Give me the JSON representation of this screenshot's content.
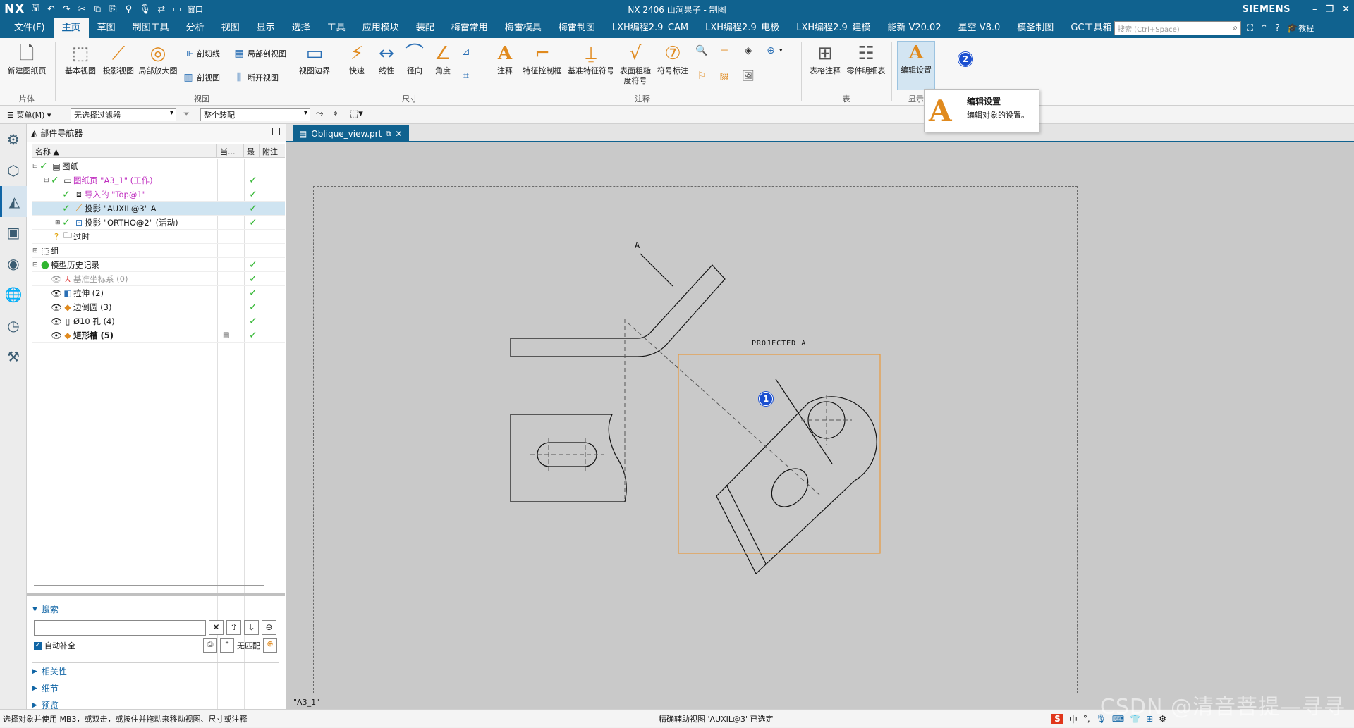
{
  "titlebar": {
    "logo": "NX",
    "window_menu": "窗口",
    "title": "NX 2406 山涧果子 - 制图",
    "brand": "SIEMENS"
  },
  "menu": {
    "items": [
      "文件(F)",
      "主页",
      "草图",
      "制图工具",
      "分析",
      "视图",
      "显示",
      "选择",
      "工具",
      "应用模块",
      "装配",
      "梅雷常用",
      "梅雷模具",
      "梅雷制图",
      "LXH编程2.9_CAM",
      "LXH编程2.9_电极",
      "LXH编程2.9_建模",
      "能新 V20.02",
      "星空 V8.0",
      "模圣制图",
      "GC工具箱"
    ],
    "search_placeholder": "搜索 (Ctrl+Space)",
    "help": "教程"
  },
  "ribbon": {
    "new_sheet": "新建图纸页",
    "base_view": "基本视图",
    "proj_view": "投影视图",
    "detail_view": "局部放大图",
    "section_line": "剖切线",
    "sect_view": "剖视图",
    "break_sect": "局部剖视图",
    "broken_view": "断开视图",
    "view_border": "视图边界",
    "rapid": "快速",
    "linear": "线性",
    "radial": "径向",
    "angular": "角度",
    "note": "注释",
    "fcf": "特征控制框",
    "datum": "基准特征符号",
    "surface1": "表面粗糙",
    "surface2": "度符号",
    "symbol": "符号标注",
    "table_note": "表格注释",
    "parts_list": "零件明细表",
    "edit_settings": "编辑设置",
    "groups": {
      "sheet": "片体",
      "view": "视图",
      "dim": "尺寸",
      "anno": "注释",
      "table": "表",
      "display": "显示"
    }
  },
  "tooltip": {
    "title": "编辑设置",
    "desc": "编辑对象的设置。"
  },
  "selbar": {
    "menu": "菜单(M)",
    "filter": "无选择过滤器",
    "assembly": "整个装配"
  },
  "navigator": {
    "title": "部件导航器",
    "cols": [
      "名称",
      "当...",
      "最",
      "附注"
    ],
    "rows": [
      {
        "label": "图纸",
        "indent": 0
      },
      {
        "label": "图纸页 \"A3_1\" (工作)",
        "indent": 1
      },
      {
        "label": "导入的 \"Top@1\"",
        "indent": 2
      },
      {
        "label": "投影 \"AUXIL@3\" A",
        "indent": 2
      },
      {
        "label": "投影 \"ORTHO@2\" (活动)",
        "indent": 2
      },
      {
        "label": "过时",
        "indent": 1
      },
      {
        "label": "组",
        "indent": 0
      },
      {
        "label": "模型历史记录",
        "indent": 0
      },
      {
        "label": "基准坐标系 (0)",
        "indent": 1
      },
      {
        "label": "拉伸 (2)",
        "indent": 1
      },
      {
        "label": "边倒圆 (3)",
        "indent": 1
      },
      {
        "label": "Ø10 孔 (4)",
        "indent": 1
      },
      {
        "label": "矩形槽 (5)",
        "indent": 1
      }
    ],
    "search_label": "搜索",
    "autocomplete": "自动补全",
    "no_match": "无匹配",
    "sections": [
      "相关性",
      "细节",
      "预览"
    ]
  },
  "tab": {
    "label": "Oblique_view.prt"
  },
  "drawing": {
    "label_a": "A",
    "projected": "PROJECTED A",
    "sheet_name": "\"A3_1\""
  },
  "badges": [
    "1",
    "2"
  ],
  "status": {
    "left": "选择对象并使用 MB3，或双击，或按住并拖动来移动视图、尺寸或注释",
    "middle": "精确辅助视图 'AUXIL@3' 已选定",
    "ime": "中"
  },
  "watermark": "CSDN @清音菩提—寻寻"
}
